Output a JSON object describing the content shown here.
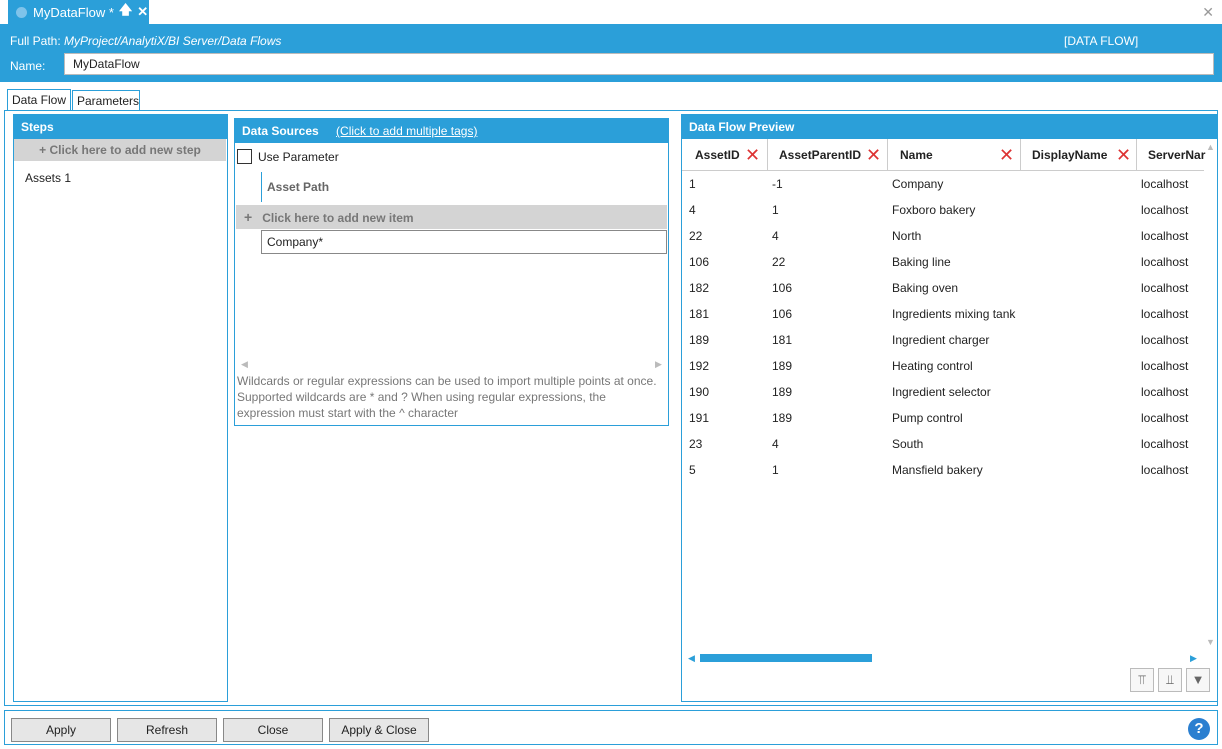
{
  "document_tab": {
    "title": "MyDataFlow *",
    "pin_glyph": "🡅",
    "close_glyph": "✕"
  },
  "window": {
    "close_glyph": "✕"
  },
  "header": {
    "full_path_label": "Full Path:",
    "full_path_value": "MyProject/AnalytiX/BI Server/Data Flows",
    "type_tag": "[DATA FLOW]",
    "name_label": "Name:",
    "name_value": "MyDataFlow"
  },
  "tabs": [
    {
      "label": "Data Flow"
    },
    {
      "label": "Parameters"
    }
  ],
  "steps": {
    "header": "Steps",
    "add_label": "+  Click here to add new step",
    "items": [
      {
        "label": "Assets  1"
      }
    ]
  },
  "data_sources": {
    "header": "Data Sources",
    "link": "(Click to add multiple tags)",
    "use_parameter_label": "Use Parameter",
    "column_header": "Asset Path",
    "add_item_plus": "+",
    "add_item_label": "Click here to add new item",
    "rows": [
      "Company*"
    ],
    "hint": "Wildcards or regular expressions can be used to import multiple points at once. Supported wildcards are * and ? When using regular expressions, the expression must start with the ^ character"
  },
  "preview": {
    "header": "Data Flow Preview",
    "columns": [
      "AssetID",
      "AssetParentID",
      "Name",
      "DisplayName",
      "ServerNar"
    ],
    "rows": [
      [
        "1",
        "-1",
        "Company",
        "",
        "localhost"
      ],
      [
        "4",
        "1",
        "Foxboro bakery",
        "",
        "localhost"
      ],
      [
        "22",
        "4",
        "North",
        "",
        "localhost"
      ],
      [
        "106",
        "22",
        "Baking line",
        "",
        "localhost"
      ],
      [
        "182",
        "106",
        "Baking oven",
        "",
        "localhost"
      ],
      [
        "181",
        "106",
        "Ingredients mixing tank",
        "",
        "localhost"
      ],
      [
        "189",
        "181",
        "Ingredient charger",
        "",
        "localhost"
      ],
      [
        "192",
        "189",
        "Heating control",
        "",
        "localhost"
      ],
      [
        "190",
        "189",
        "Ingredient selector",
        "",
        "localhost"
      ],
      [
        "191",
        "189",
        "Pump control",
        "",
        "localhost"
      ],
      [
        "23",
        "4",
        "South",
        "",
        "localhost"
      ],
      [
        "5",
        "1",
        "Mansfield bakery",
        "",
        "localhost"
      ]
    ],
    "remove_glyph": "✕",
    "tools": [
      {
        "name": "filter-columns-icon",
        "glyph": "⫪"
      },
      {
        "name": "clear-filter-icon",
        "glyph": "⫫"
      },
      {
        "name": "funnel-icon",
        "glyph": "▼"
      }
    ]
  },
  "footer": {
    "apply": "Apply",
    "refresh": "Refresh",
    "close": "Close",
    "apply_close": "Apply & Close",
    "help": "?"
  }
}
